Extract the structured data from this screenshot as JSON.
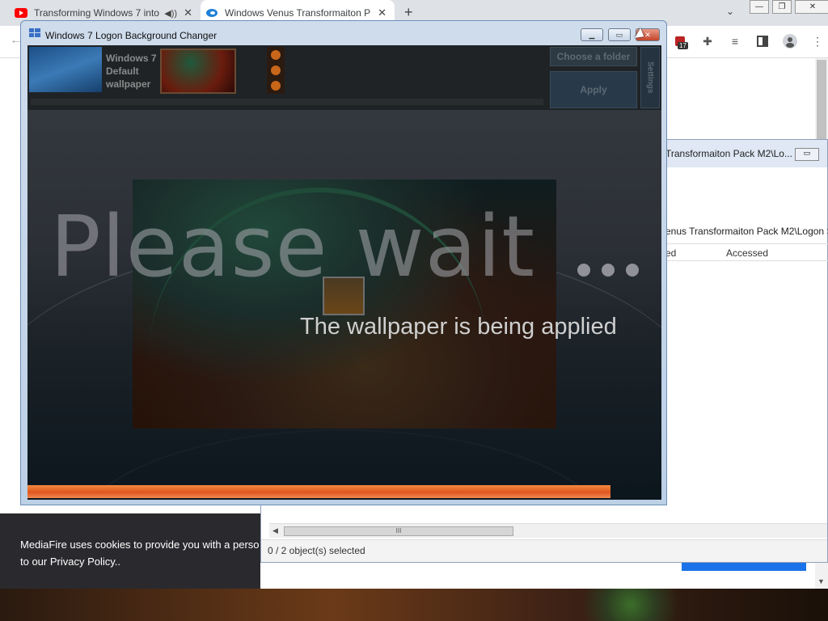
{
  "browser": {
    "tabs": [
      {
        "title": "Transforming Windows 7 into",
        "favicon": "youtube-icon",
        "audio": true
      },
      {
        "title": "Windows Venus Transformaiton P",
        "favicon": "mediafire-icon",
        "active": true
      }
    ],
    "new_tab": "+",
    "extension_badge": "17"
  },
  "explorer": {
    "title": "Transformaiton Pack M2\\Lo...",
    "address": "enus Transformaiton Pack M2\\Logon S",
    "columns": [
      "ed",
      "Accessed"
    ],
    "scroll_grip": "III",
    "status": "0 / 2 object(s) selected"
  },
  "cookie": {
    "line1": "MediaFire uses cookies to provide you with a perso",
    "line2": "to our Privacy Policy.."
  },
  "app": {
    "title": "Windows 7 Logon Background Changer",
    "thumb_label": "Windows 7 Default wallpaper",
    "choose_folder": "Choose a folder",
    "apply": "Apply",
    "settings": "Settings",
    "overlay_title": "Please wait",
    "overlay_subtitle": "The wallpaper is being applied",
    "progress": 0.92,
    "accent_color": "#e8662a"
  }
}
